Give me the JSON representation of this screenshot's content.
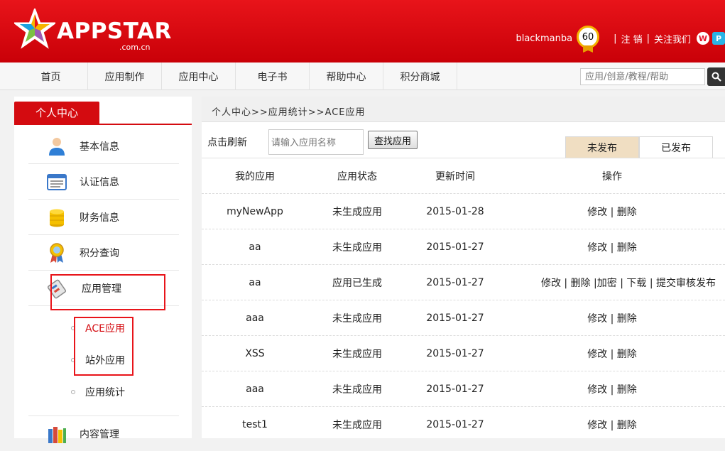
{
  "header": {
    "brand": "APPSTAR",
    "domain": ".com.cn",
    "username": "blackmanba",
    "level": "60",
    "logout": "注 销",
    "follow": "关注我们",
    "sep": "|",
    "weibo_icon": "weibo-icon",
    "qzone_icon": "qzone-icon"
  },
  "nav": {
    "items": [
      "首页",
      "应用制作",
      "应用中心",
      "电子书",
      "帮助中心",
      "积分商城"
    ],
    "search_placeholder": "应用/创意/教程/帮助"
  },
  "sidebar": {
    "title": "个人中心",
    "items": [
      {
        "label": "基本信息",
        "icon": "user-icon"
      },
      {
        "label": "认证信息",
        "icon": "id-card-icon"
      },
      {
        "label": "财务信息",
        "icon": "coins-icon"
      },
      {
        "label": "积分查询",
        "icon": "medal-icon"
      },
      {
        "label": "应用管理",
        "icon": "app-manage-icon"
      },
      {
        "label": "内容管理",
        "icon": "books-icon"
      }
    ],
    "sub_items": [
      "ACE应用",
      "站外应用",
      "应用统计"
    ]
  },
  "main": {
    "breadcrumb": "个人中心>>应用统计>>ACE应用",
    "refresh_label": "点击刷新",
    "search_placeholder": "请输入应用名称",
    "find_button": "查找应用",
    "tabs": [
      "未发布",
      "已发布"
    ],
    "columns": [
      "我的应用",
      "应用状态",
      "更新时间",
      "操作"
    ],
    "rows": [
      {
        "name": "myNewApp",
        "status": "未生成应用",
        "date": "2015-01-28",
        "ops": "修改 | 删除"
      },
      {
        "name": "aa",
        "status": "未生成应用",
        "date": "2015-01-27",
        "ops": "修改 | 删除"
      },
      {
        "name": "aa",
        "status": "应用已生成",
        "date": "2015-01-27",
        "ops": "修改 | 删除 |加密 | 下载 | 提交审核发布"
      },
      {
        "name": "aaa",
        "status": "未生成应用",
        "date": "2015-01-27",
        "ops": "修改 | 删除"
      },
      {
        "name": "XSS",
        "status": "未生成应用",
        "date": "2015-01-27",
        "ops": "修改 | 删除"
      },
      {
        "name": "aaa",
        "status": "未生成应用",
        "date": "2015-01-27",
        "ops": "修改 | 删除"
      },
      {
        "name": "test1",
        "status": "未生成应用",
        "date": "2015-01-27",
        "ops": "修改 | 删除"
      }
    ]
  },
  "colors": {
    "brand_red": "#d40b10",
    "tab_active": "#f0dec2"
  }
}
